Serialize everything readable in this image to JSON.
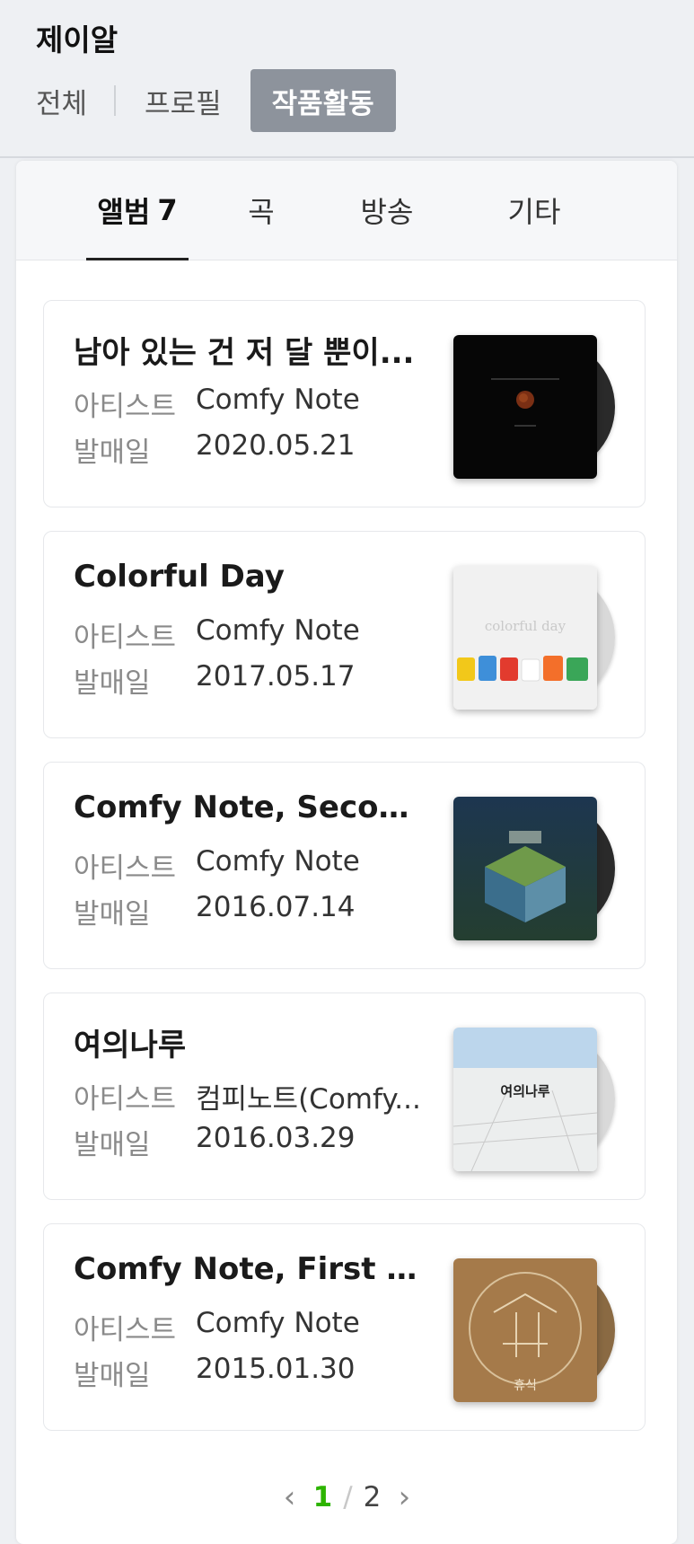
{
  "header": {
    "artist_name": "제이알",
    "tabs": [
      {
        "label": "전체"
      },
      {
        "label": "프로필"
      },
      {
        "label": "작품활동",
        "active": true
      }
    ]
  },
  "sub_tabs": [
    {
      "label": "앨범",
      "count": "7",
      "active": true
    },
    {
      "label": "곡"
    },
    {
      "label": "방송"
    },
    {
      "label": "기타"
    }
  ],
  "labels": {
    "artist": "아티스트",
    "release": "발매일"
  },
  "albums": [
    {
      "title": "남아 있는 건 저 달 뿐이...",
      "artist": "Comfy Note",
      "date": "2020.05.21",
      "cover_text": ""
    },
    {
      "title": "Colorful Day",
      "artist": "Comfy Note",
      "date": "2017.05.17",
      "cover_text": "colorful day"
    },
    {
      "title": "Comfy Note, Second ...",
      "artist": "Comfy Note",
      "date": "2016.07.14",
      "cover_text": ""
    },
    {
      "title": "여의나루",
      "artist": "컴피노트(Comfy...",
      "date": "2016.03.29",
      "cover_text": "여의나루"
    },
    {
      "title": "Comfy Note, First Not...",
      "artist": "Comfy Note",
      "date": "2015.01.30",
      "cover_text": "휴식"
    }
  ],
  "pagination": {
    "current": "1",
    "separator": "/",
    "other": "2"
  },
  "colors": {
    "accent_green": "#2db400",
    "active_tab_bg": "#8d939c"
  }
}
